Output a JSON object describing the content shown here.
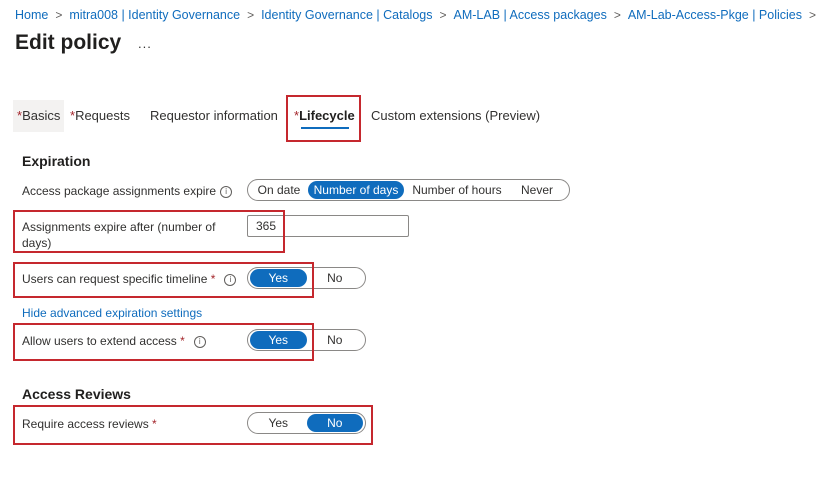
{
  "breadcrumb": [
    "Home",
    "mitra008 | Identity Governance",
    "Identity Governance | Catalogs",
    "AM-LAB | Access packages",
    "AM-Lab-Access-Pkge | Policies"
  ],
  "breadcrumb_separator": ">",
  "page": {
    "title": "Edit policy",
    "more_label": "..."
  },
  "tabs": [
    {
      "label": "Basics",
      "required": true
    },
    {
      "label": "Requests",
      "required": true
    },
    {
      "label": "Requestor information",
      "required": false
    },
    {
      "label": "Lifecycle",
      "required": true,
      "selected": true
    },
    {
      "label": "Custom extensions (Preview)",
      "required": false
    }
  ],
  "required_marker": "*",
  "expiration": {
    "title": "Expiration",
    "expire_label": "Access package assignments expire",
    "expire_options": [
      "On date",
      "Number of days",
      "Number of hours",
      "Never"
    ],
    "expire_selected": "Number of days",
    "days_label_line1": "Assignments expire after (number of",
    "days_label_line2": "days)",
    "days_value": "365",
    "timeline_label": "Users can request specific timeline",
    "timeline_options": [
      "Yes",
      "No"
    ],
    "timeline_selected": "Yes",
    "advanced_link": "Hide advanced expiration settings",
    "extend_label": "Allow users to extend access",
    "extend_options": [
      "Yes",
      "No"
    ],
    "extend_selected": "Yes"
  },
  "access_reviews": {
    "title": "Access Reviews",
    "require_label": "Require access reviews",
    "require_options": [
      "Yes",
      "No"
    ],
    "require_selected": "No"
  },
  "colors": {
    "accent": "#0f6cbd",
    "highlight": "#c5282e",
    "required": "#a4262c"
  },
  "icons": {
    "info": "info-icon",
    "breadcrumb_sep": "chevron-right-icon"
  }
}
